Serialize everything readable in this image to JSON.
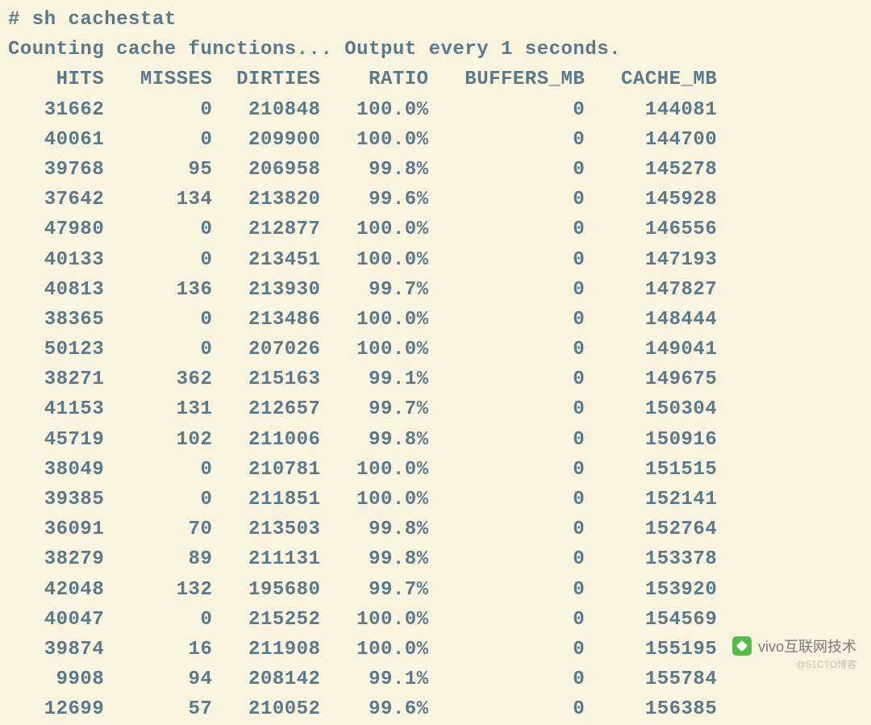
{
  "terminal": {
    "prompt": "# sh cachestat",
    "status": "Counting cache functions... Output every 1 seconds.",
    "columns": [
      "HITS",
      "MISSES",
      "DIRTIES",
      "RATIO",
      "BUFFERS_MB",
      "CACHE_MB"
    ],
    "rows": [
      {
        "hits": "31662",
        "misses": "0",
        "dirties": "210848",
        "ratio": "100.0%",
        "buffers_mb": "0",
        "cache_mb": "144081"
      },
      {
        "hits": "40061",
        "misses": "0",
        "dirties": "209900",
        "ratio": "100.0%",
        "buffers_mb": "0",
        "cache_mb": "144700"
      },
      {
        "hits": "39768",
        "misses": "95",
        "dirties": "206958",
        "ratio": "99.8%",
        "buffers_mb": "0",
        "cache_mb": "145278"
      },
      {
        "hits": "37642",
        "misses": "134",
        "dirties": "213820",
        "ratio": "99.6%",
        "buffers_mb": "0",
        "cache_mb": "145928"
      },
      {
        "hits": "47980",
        "misses": "0",
        "dirties": "212877",
        "ratio": "100.0%",
        "buffers_mb": "0",
        "cache_mb": "146556"
      },
      {
        "hits": "40133",
        "misses": "0",
        "dirties": "213451",
        "ratio": "100.0%",
        "buffers_mb": "0",
        "cache_mb": "147193"
      },
      {
        "hits": "40813",
        "misses": "136",
        "dirties": "213930",
        "ratio": "99.7%",
        "buffers_mb": "0",
        "cache_mb": "147827"
      },
      {
        "hits": "38365",
        "misses": "0",
        "dirties": "213486",
        "ratio": "100.0%",
        "buffers_mb": "0",
        "cache_mb": "148444"
      },
      {
        "hits": "50123",
        "misses": "0",
        "dirties": "207026",
        "ratio": "100.0%",
        "buffers_mb": "0",
        "cache_mb": "149041"
      },
      {
        "hits": "38271",
        "misses": "362",
        "dirties": "215163",
        "ratio": "99.1%",
        "buffers_mb": "0",
        "cache_mb": "149675"
      },
      {
        "hits": "41153",
        "misses": "131",
        "dirties": "212657",
        "ratio": "99.7%",
        "buffers_mb": "0",
        "cache_mb": "150304"
      },
      {
        "hits": "45719",
        "misses": "102",
        "dirties": "211006",
        "ratio": "99.8%",
        "buffers_mb": "0",
        "cache_mb": "150916"
      },
      {
        "hits": "38049",
        "misses": "0",
        "dirties": "210781",
        "ratio": "100.0%",
        "buffers_mb": "0",
        "cache_mb": "151515"
      },
      {
        "hits": "39385",
        "misses": "0",
        "dirties": "211851",
        "ratio": "100.0%",
        "buffers_mb": "0",
        "cache_mb": "152141"
      },
      {
        "hits": "36091",
        "misses": "70",
        "dirties": "213503",
        "ratio": "99.8%",
        "buffers_mb": "0",
        "cache_mb": "152764"
      },
      {
        "hits": "38279",
        "misses": "89",
        "dirties": "211131",
        "ratio": "99.8%",
        "buffers_mb": "0",
        "cache_mb": "153378"
      },
      {
        "hits": "42048",
        "misses": "132",
        "dirties": "195680",
        "ratio": "99.7%",
        "buffers_mb": "0",
        "cache_mb": "153920"
      },
      {
        "hits": "40047",
        "misses": "0",
        "dirties": "215252",
        "ratio": "100.0%",
        "buffers_mb": "0",
        "cache_mb": "154569"
      },
      {
        "hits": "39874",
        "misses": "16",
        "dirties": "211908",
        "ratio": "100.0%",
        "buffers_mb": "0",
        "cache_mb": "155195"
      },
      {
        "hits": "9908",
        "misses": "94",
        "dirties": "208142",
        "ratio": "99.1%",
        "buffers_mb": "0",
        "cache_mb": "155784"
      },
      {
        "hits": "12699",
        "misses": "57",
        "dirties": "210052",
        "ratio": "99.6%",
        "buffers_mb": "0",
        "cache_mb": "156385"
      }
    ]
  },
  "watermark": {
    "main": "vivo互联网技术",
    "sub": "@51CTO博客"
  },
  "column_widths": {
    "hits": 8,
    "misses": 9,
    "dirties": 9,
    "ratio": 9,
    "buffers_mb": 13,
    "cache_mb": 11
  }
}
